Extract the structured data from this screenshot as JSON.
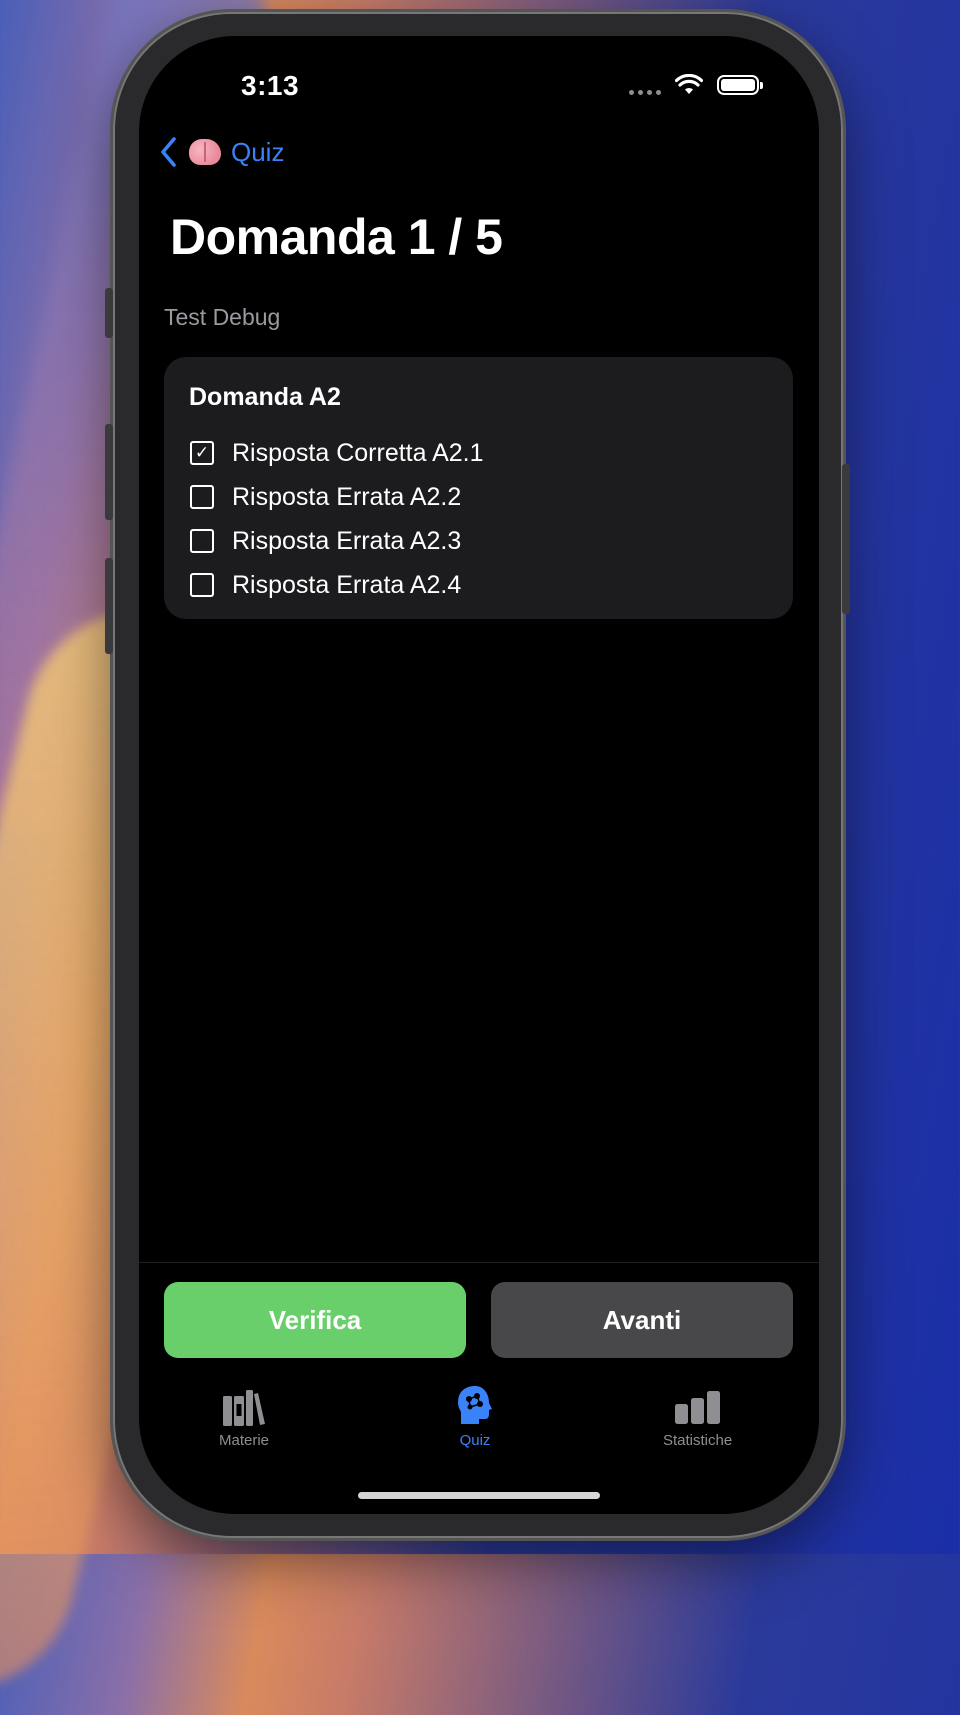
{
  "status_bar": {
    "time": "3:13"
  },
  "nav": {
    "back_label": "Quiz"
  },
  "page": {
    "title": "Domanda 1 / 5",
    "subtitle": "Test Debug"
  },
  "question": {
    "title": "Domanda A2",
    "answers": [
      {
        "label": "Risposta Corretta A2.1",
        "checked": true
      },
      {
        "label": "Risposta Errata A2.2",
        "checked": false
      },
      {
        "label": "Risposta Errata A2.3",
        "checked": false
      },
      {
        "label": "Risposta Errata A2.4",
        "checked": false
      }
    ]
  },
  "actions": {
    "verify_label": "Verifica",
    "next_label": "Avanti"
  },
  "tabbar": {
    "items": [
      {
        "label": "Materie",
        "icon": "books-icon",
        "active": false
      },
      {
        "label": "Quiz",
        "icon": "brain-head-icon",
        "active": true
      },
      {
        "label": "Statistiche",
        "icon": "bar-chart-icon",
        "active": false
      }
    ]
  },
  "colors": {
    "accent": "#3a82f7",
    "verify": "#68cf6a",
    "next": "#48484a",
    "card": "#1c1c1e"
  }
}
